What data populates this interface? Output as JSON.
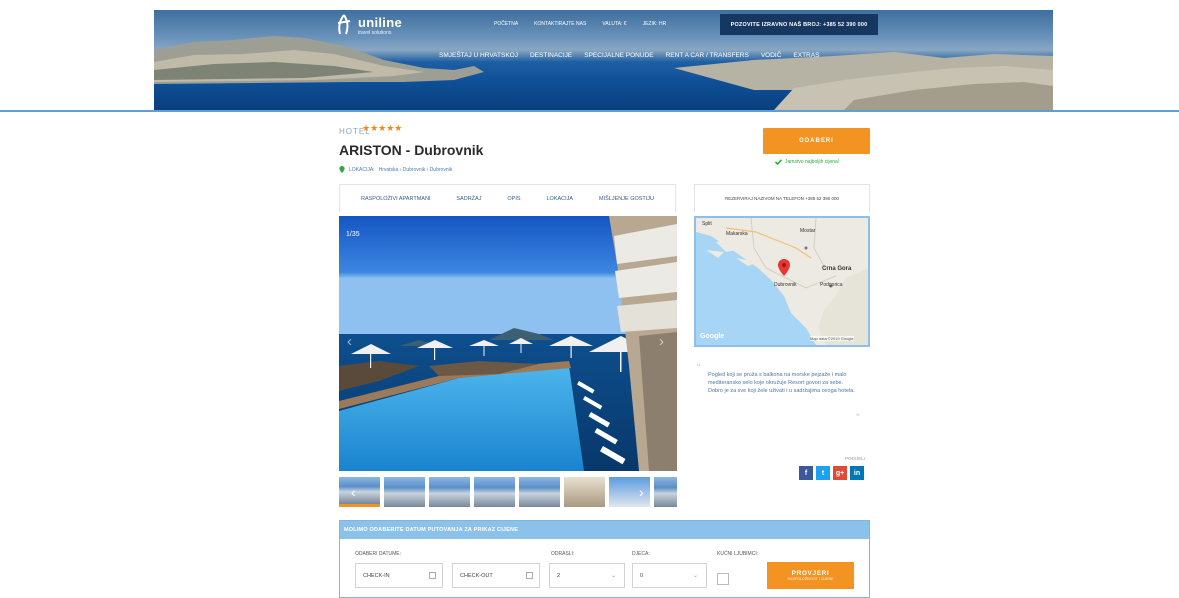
{
  "brand": {
    "name": "uniline",
    "tagline": "travel solutions"
  },
  "topnav": [
    "POČETNA",
    "KONTAKTIRAJTE NAS",
    "VALUTA: €",
    "JEZIK: HR"
  ],
  "call_box": "POZOVITE IZRAVNO NAŠ BROJ: +385 52 390 000",
  "mainnav": [
    "SMJEŠTAJ U HRVATSKOJ",
    "DESTINACIJE",
    "SPECIJALNE PONUDE",
    "RENT A CAR / TRANSFERS",
    "VODIČ",
    "EXTRAS"
  ],
  "hotel": {
    "kind": "HOTEL",
    "stars": 5,
    "stars_text": "★★★★★",
    "title": "ARISTON - Dubrovnik",
    "location_label": "LOKACIJA:",
    "location_value": "Hrvatska › Dubrovnik › Dubrovnik"
  },
  "reserve": {
    "label": "ODABERI",
    "guarantee": "Jamstvo najboljih cijena!"
  },
  "tabs": [
    "RASPOLOŽIVI APARTMANI",
    "SADRŽAJ",
    "OPIS",
    "LOKACIJA",
    "MIŠLJENJE GOSTIJU"
  ],
  "phone_line": "REZERVIRAJ NAZIVOM NA TELEFON +385 52 390 000",
  "gallery": {
    "counter": "1/35",
    "thumb_count": 8
  },
  "map": {
    "labels": [
      "Split",
      "Makarska",
      "Mostar",
      "Crna Gora",
      "Podgorica",
      "Dubrovnik"
    ],
    "google": "Google",
    "credits": "Map data ©2019 Google"
  },
  "quote": "Pogled koji se pruža s balkona na morske pejzaže i malo mediteransko selo koje okružuje Resort govori za sebe. Dobro je za sve koji žele uživati i u sadržajima ovoga hotela.",
  "share": {
    "label": "PODIJELI",
    "items": [
      "f",
      "t",
      "g+",
      "in"
    ]
  },
  "booking": {
    "header": "MOLIMO ODABERITE DATUM PUTOVANJA ZA PRIKAZ CIJENE",
    "dates_label": "ODABERI DATUME:",
    "checkin": "CHECK-IN",
    "checkout": "CHECK-OUT",
    "adults_label": "ODRASLI:",
    "adults_value": "2",
    "children_label": "DJECA:",
    "children_value": "0",
    "pets_label": "KUĆNI LJUBIMCI:",
    "check_button": "PROVJERI",
    "check_button_sub": "RASPOLOŽIVOST I CIJENE"
  },
  "colors": {
    "accent": "#f39322",
    "link": "#385a86",
    "header_dark": "#16375f"
  }
}
